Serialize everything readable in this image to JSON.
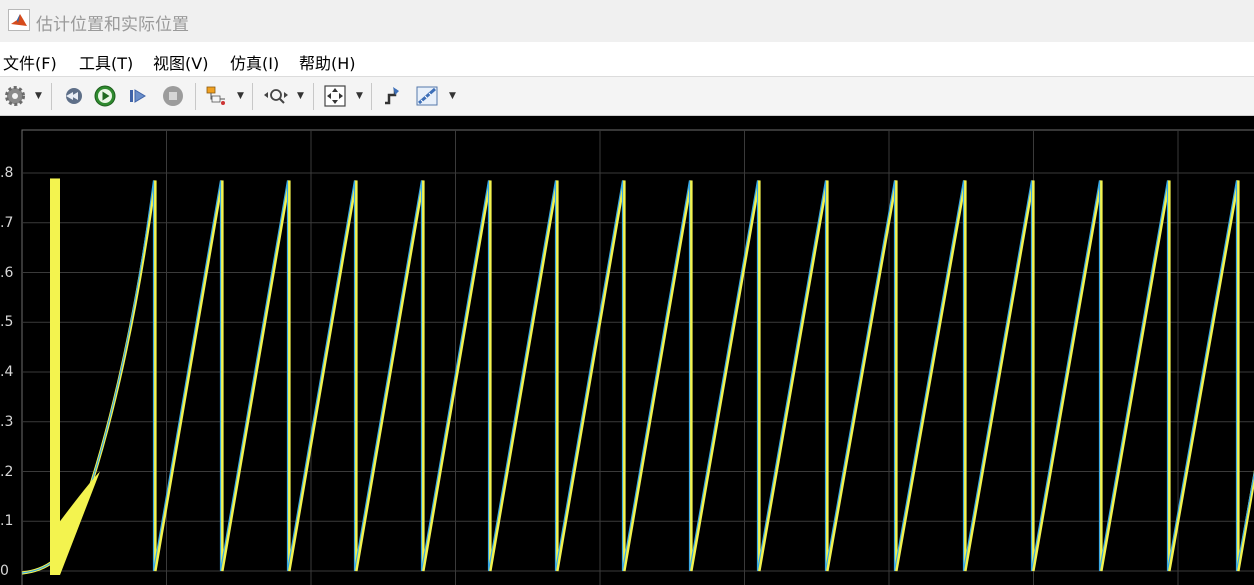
{
  "window": {
    "title": "估计位置和实际位置"
  },
  "menu": [
    "文件(F)",
    "工具(T)",
    "视图(V)",
    "仿真(I)",
    "帮助(H)"
  ],
  "toolbar": {
    "buttons": [
      {
        "name": "settings-gear-icon",
        "has_dropdown": true
      },
      {
        "name": "step-back-icon",
        "has_dropdown": false
      },
      {
        "name": "run-icon",
        "has_dropdown": false
      },
      {
        "name": "step-forward-icon",
        "has_dropdown": false
      },
      {
        "name": "stop-icon",
        "has_dropdown": false
      },
      {
        "name": "signal-select-icon",
        "has_dropdown": true
      },
      {
        "name": "zoom-icon",
        "has_dropdown": true
      },
      {
        "name": "fit-view-icon",
        "has_dropdown": true
      },
      {
        "name": "style-icon",
        "has_dropdown": false
      },
      {
        "name": "measure-icon",
        "has_dropdown": true
      }
    ]
  },
  "chart_data": {
    "type": "line",
    "y_tick_labels": [
      ".8",
      ".7",
      ".6",
      ".5",
      ".4",
      ".3",
      ".2",
      ".1",
      "0"
    ],
    "y_ticks": [
      0.8,
      0.7,
      0.6,
      0.5,
      0.4,
      0.3,
      0.2,
      0.1,
      0
    ],
    "ylim": [
      -0.015,
      0.9
    ],
    "background": "#000000",
    "grid": true,
    "series": [
      {
        "color": "#f3f34f",
        "sawtooth_period": 0.118,
        "max": 0.785
      },
      {
        "color": "#39a9e6",
        "sawtooth_period": 0.118,
        "max": 0.785
      }
    ]
  }
}
